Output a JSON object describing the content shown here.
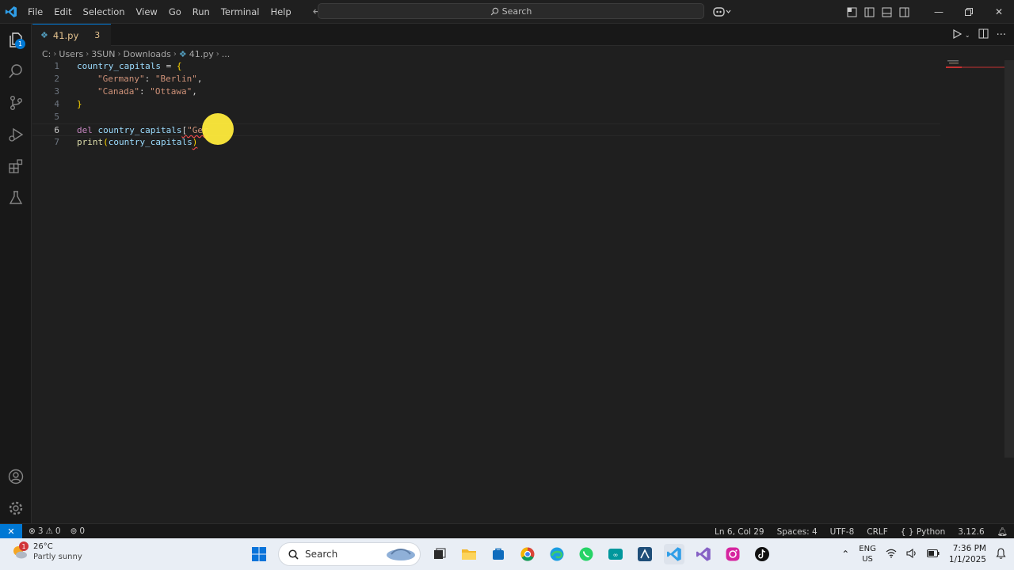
{
  "menu": [
    "File",
    "Edit",
    "Selection",
    "View",
    "Go",
    "Run",
    "Terminal",
    "Help"
  ],
  "search": {
    "label": "Search"
  },
  "tab": {
    "filename": "41.py",
    "problems": "3"
  },
  "breadcrumb": [
    "C:",
    "Users",
    "3SUN",
    "Downloads",
    "41.py",
    "..."
  ],
  "activity_badge": "1",
  "code": {
    "line_numbers": [
      "1",
      "2",
      "3",
      "4",
      "5",
      "6",
      "7"
    ],
    "l1": {
      "var": "country_capitals",
      "op": " = ",
      "brace": "{"
    },
    "l2": {
      "key": "\"Germany\"",
      "sep": ": ",
      "val": "\"Berlin\"",
      "comma": ","
    },
    "l3": {
      "key": "\"Canada\"",
      "sep": ": ",
      "val": "\"Ottawa\"",
      "comma": ","
    },
    "l4": {
      "brace": "}"
    },
    "l6": {
      "kw": "del",
      "var": "country_capitals",
      "bracket": "[",
      "str": "\"Ger"
    },
    "l7": {
      "fn": "print",
      "open": "(",
      "var": "country_capitals",
      "close": ")"
    }
  },
  "status": {
    "errors": "3",
    "warnings": "0",
    "ports": "0",
    "position": "Ln 6, Col 29",
    "spaces": "Spaces: 4",
    "encoding": "UTF-8",
    "eol": "CRLF",
    "language": "Python",
    "version": "3.12.6"
  },
  "taskbar": {
    "weather_temp": "26°C",
    "weather_desc": "Partly sunny",
    "weather_badge": "1",
    "search": "Search",
    "lang_top": "ENG",
    "lang_bottom": "US",
    "time": "7:36 PM",
    "date": "1/1/2025"
  },
  "colors": {
    "accent": "#0078d4",
    "cursor_highlight": "#ffeb3b"
  }
}
